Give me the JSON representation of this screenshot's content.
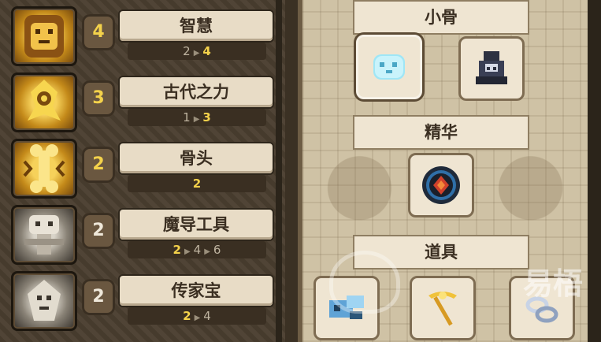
{
  "synergies": [
    {
      "count": "4",
      "name": "智慧",
      "tiers": [
        {
          "v": "2",
          "on": false
        },
        {
          "v": "4",
          "on": true
        }
      ],
      "emblem": "lion-face-icon",
      "style": "gold"
    },
    {
      "count": "3",
      "name": "古代之力",
      "tiers": [
        {
          "v": "1",
          "on": false
        },
        {
          "v": "3",
          "on": true
        }
      ],
      "emblem": "ancient-power-icon",
      "style": "gold"
    },
    {
      "count": "2",
      "name": "骨头",
      "tiers": [
        {
          "v": "2",
          "on": true
        }
      ],
      "emblem": "bone-icon",
      "style": "gold"
    },
    {
      "count": "2",
      "name": "魔导工具",
      "tiers": [
        {
          "v": "2",
          "on": true
        },
        {
          "v": "4",
          "on": false
        },
        {
          "v": "6",
          "on": false
        }
      ],
      "emblem": "magic-tool-icon",
      "style": "grey"
    },
    {
      "count": "2",
      "name": "传家宝",
      "tiers": [
        {
          "v": "2",
          "on": true
        },
        {
          "v": "4",
          "on": false
        }
      ],
      "emblem": "heirloom-icon",
      "style": "grey"
    }
  ],
  "sections": {
    "skull": "小骨",
    "essence": "精华",
    "items": "道具"
  },
  "watermark": "易梧",
  "colors": {
    "gold": "#f4d24b",
    "plate": "#e8dcc6",
    "panel": "#cfc2a5"
  }
}
